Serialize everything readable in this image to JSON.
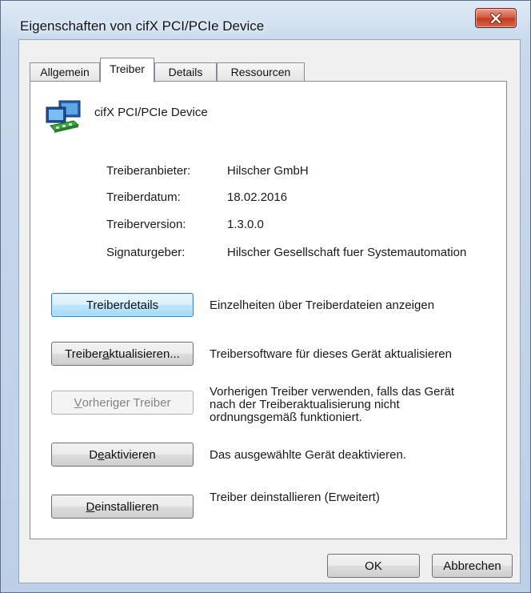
{
  "window": {
    "title": "Eigenschaften von cifX PCI/PCIe Device"
  },
  "tabs": [
    {
      "label": "Allgemein",
      "active": false
    },
    {
      "label": "Treiber",
      "active": true
    },
    {
      "label": "Details",
      "active": false
    },
    {
      "label": "Ressourcen",
      "active": false
    }
  ],
  "device": {
    "name": "cifX PCI/PCIe Device",
    "icon": "network-adapter-icon"
  },
  "driver_info": [
    {
      "label": "Treiberanbieter:",
      "value": "Hilscher GmbH"
    },
    {
      "label": "Treiberdatum:",
      "value": "18.02.2016"
    },
    {
      "label": "Treiberversion:",
      "value": "1.3.0.0"
    },
    {
      "label": "Signaturgeber:",
      "value": "Hilscher Gesellschaft fuer Systemautomation"
    }
  ],
  "actions": [
    {
      "label_pre": "Treiberdetails",
      "label_ul": "",
      "label_post": "",
      "description": "Einzelheiten über Treiberdateien anzeigen",
      "state": "focused"
    },
    {
      "label_pre": "Treiber ",
      "label_ul": "a",
      "label_post": "ktualisieren...",
      "description": "Treibersoftware für dieses Gerät aktualisieren",
      "state": "normal"
    },
    {
      "label_pre": "",
      "label_ul": "V",
      "label_post": "orheriger Treiber",
      "description": "Vorherigen Treiber verwenden, falls das Gerät nach der Treiberaktualisierung nicht ordnungsgemäß funktioniert.",
      "state": "disabled"
    },
    {
      "label_pre": "D",
      "label_ul": "e",
      "label_post": "aktivieren",
      "description": "Das ausgewählte Gerät deaktivieren.",
      "state": "normal"
    },
    {
      "label_pre": "",
      "label_ul": "D",
      "label_post": "einstallieren",
      "description": "Treiber deinstallieren (Erweitert)",
      "state": "normal"
    }
  ],
  "footer": {
    "ok_label": "OK",
    "cancel_label": "Abbrechen"
  },
  "colors": {
    "title_gradient": "#c9d9ec",
    "close_button": "#c13a1e",
    "focused_button": "#bee6fd"
  }
}
